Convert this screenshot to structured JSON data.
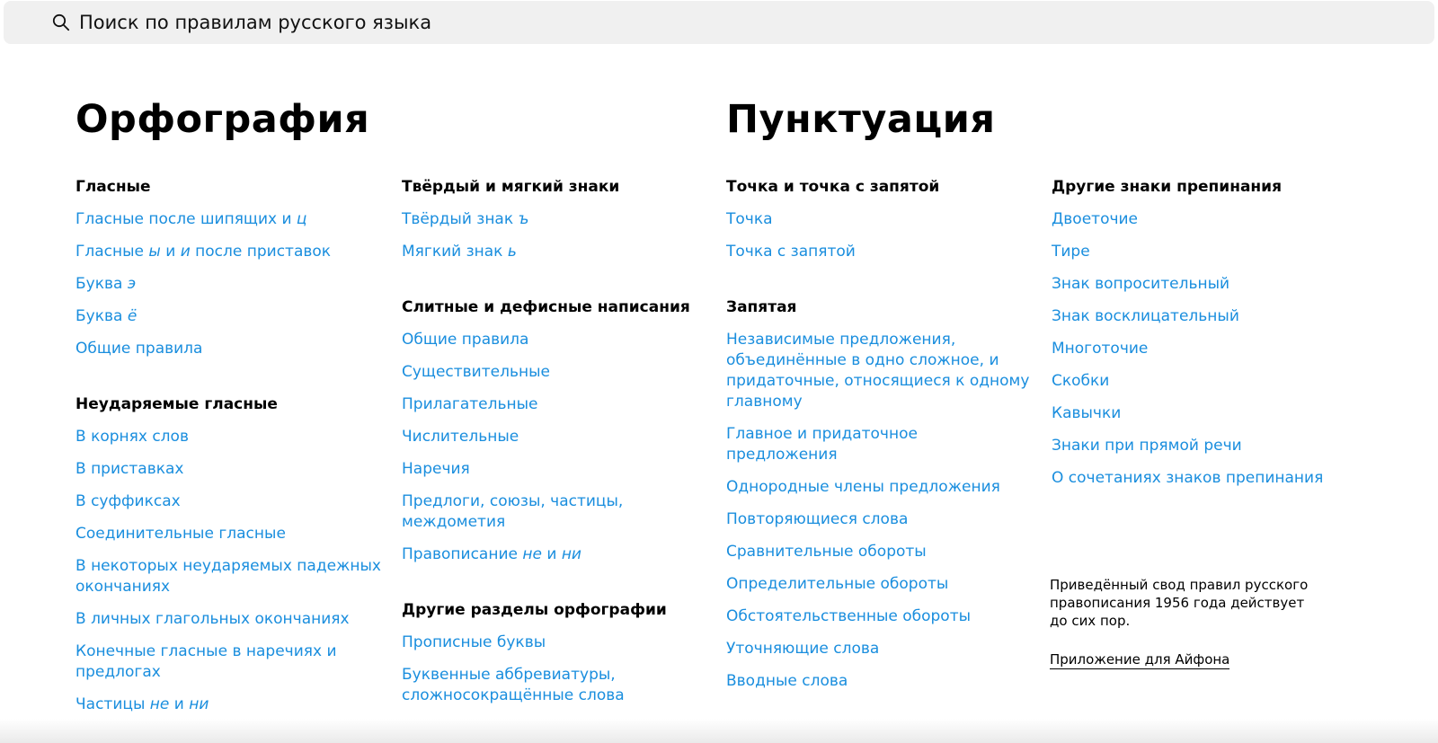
{
  "search": {
    "placeholder": "Поиск по правилам русского языка"
  },
  "orthography": {
    "title": "Орфография",
    "col1": [
      {
        "title": "Гласные",
        "links": [
          {
            "parts": [
              {
                "t": "Гласные после шипящих и "
              },
              {
                "t": "ц",
                "i": true
              }
            ]
          },
          {
            "parts": [
              {
                "t": "Гласные "
              },
              {
                "t": "ы",
                "i": true
              },
              {
                "t": " и "
              },
              {
                "t": "и",
                "i": true
              },
              {
                "t": " после приставок"
              }
            ]
          },
          {
            "parts": [
              {
                "t": "Буква "
              },
              {
                "t": "э",
                "i": true
              }
            ]
          },
          {
            "parts": [
              {
                "t": "Буква "
              },
              {
                "t": "ё",
                "i": true
              }
            ]
          },
          {
            "parts": [
              {
                "t": "Общие правила"
              }
            ]
          }
        ]
      },
      {
        "title": "Неударяемые гласные",
        "links": [
          {
            "parts": [
              {
                "t": "В корнях слов"
              }
            ]
          },
          {
            "parts": [
              {
                "t": "В приставках"
              }
            ]
          },
          {
            "parts": [
              {
                "t": "В суффиксах"
              }
            ]
          },
          {
            "parts": [
              {
                "t": "Соединительные гласные"
              }
            ]
          },
          {
            "parts": [
              {
                "t": "В некоторых неударяемых падежных окончаниях"
              }
            ]
          },
          {
            "parts": [
              {
                "t": "В личных глагольных окончаниях"
              }
            ]
          },
          {
            "parts": [
              {
                "t": "Конечные гласные в наречиях и предлогах"
              }
            ]
          },
          {
            "parts": [
              {
                "t": "Частицы "
              },
              {
                "t": "не",
                "i": true
              },
              {
                "t": " и "
              },
              {
                "t": "ни",
                "i": true
              }
            ]
          }
        ]
      }
    ],
    "col2": [
      {
        "title": "Твёрдый и мягкий знаки",
        "links": [
          {
            "parts": [
              {
                "t": "Твёрдый знак "
              },
              {
                "t": "ъ",
                "i": true
              }
            ]
          },
          {
            "parts": [
              {
                "t": "Мягкий знак "
              },
              {
                "t": "ь",
                "i": true
              }
            ]
          }
        ]
      },
      {
        "title": "Слитные и дефисные написания",
        "links": [
          {
            "parts": [
              {
                "t": "Общие правила"
              }
            ]
          },
          {
            "parts": [
              {
                "t": "Существительные"
              }
            ]
          },
          {
            "parts": [
              {
                "t": "Прилагательные"
              }
            ]
          },
          {
            "parts": [
              {
                "t": "Числительные"
              }
            ]
          },
          {
            "parts": [
              {
                "t": "Наречия"
              }
            ]
          },
          {
            "parts": [
              {
                "t": "Предлоги, союзы, частицы, междометия"
              }
            ]
          },
          {
            "parts": [
              {
                "t": "Правописание "
              },
              {
                "t": "не",
                "i": true
              },
              {
                "t": " и "
              },
              {
                "t": "ни",
                "i": true
              }
            ]
          }
        ]
      },
      {
        "title": "Другие разделы орфографии",
        "links": [
          {
            "parts": [
              {
                "t": "Прописные буквы"
              }
            ]
          },
          {
            "parts": [
              {
                "t": "Буквенные аббревиатуры, сложносокращённые слова"
              }
            ]
          }
        ]
      }
    ]
  },
  "punctuation": {
    "title": "Пунктуация",
    "col3": [
      {
        "title": "Точка и точка с запятой",
        "links": [
          {
            "parts": [
              {
                "t": "Точка"
              }
            ]
          },
          {
            "parts": [
              {
                "t": "Точка с запятой"
              }
            ]
          }
        ]
      },
      {
        "title": "Запятая",
        "links": [
          {
            "parts": [
              {
                "t": "Независимые предложения, объединённые в одно сложное, и придаточные, относящиеся к одному главному"
              }
            ]
          },
          {
            "parts": [
              {
                "t": "Главное и придаточное предложения"
              }
            ]
          },
          {
            "parts": [
              {
                "t": "Однородные члены предложения"
              }
            ]
          },
          {
            "parts": [
              {
                "t": "Повторяющиеся слова"
              }
            ]
          },
          {
            "parts": [
              {
                "t": "Сравнительные обороты"
              }
            ]
          },
          {
            "parts": [
              {
                "t": "Определительные обороты"
              }
            ]
          },
          {
            "parts": [
              {
                "t": "Обстоятельственные обороты"
              }
            ]
          },
          {
            "parts": [
              {
                "t": "Уточняющие слова"
              }
            ]
          },
          {
            "parts": [
              {
                "t": "Вводные слова"
              }
            ]
          }
        ]
      }
    ],
    "col4": [
      {
        "title": "Другие знаки препинания",
        "links": [
          {
            "parts": [
              {
                "t": "Двоеточие"
              }
            ]
          },
          {
            "parts": [
              {
                "t": "Тире"
              }
            ]
          },
          {
            "parts": [
              {
                "t": "Знак вопросительный"
              }
            ]
          },
          {
            "parts": [
              {
                "t": "Знак восклицательный"
              }
            ]
          },
          {
            "parts": [
              {
                "t": "Многоточие"
              }
            ]
          },
          {
            "parts": [
              {
                "t": "Скобки"
              }
            ]
          },
          {
            "parts": [
              {
                "t": "Кавычки"
              }
            ]
          },
          {
            "parts": [
              {
                "t": "Знаки при прямой речи"
              }
            ]
          },
          {
            "parts": [
              {
                "t": "О сочетаниях знаков препинания"
              }
            ]
          }
        ]
      }
    ]
  },
  "note": "Приведённый свод правил русского правописания 1956 года действует до сих пор.",
  "app_link": "Приложение для Айфона",
  "colors": {
    "link": "#1a8ede",
    "search_bg": "#f0f0f0",
    "text": "#000000"
  }
}
